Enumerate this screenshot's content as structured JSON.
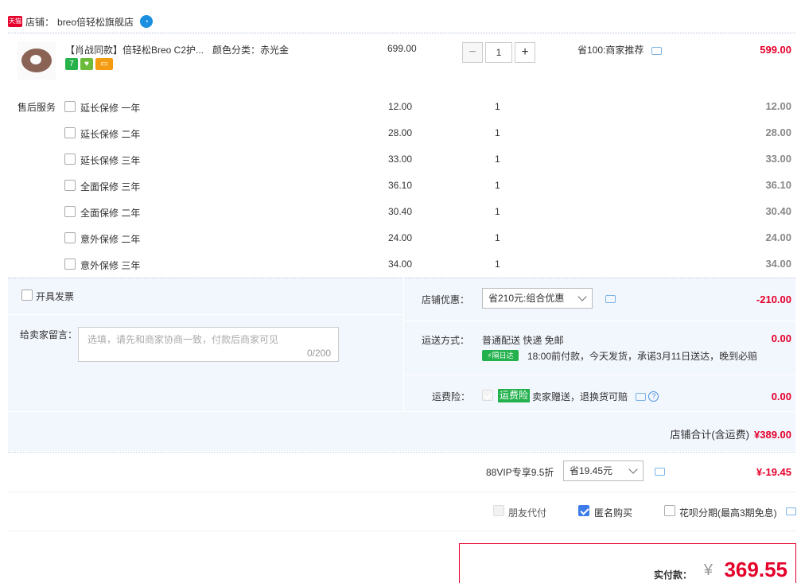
{
  "store": {
    "badge": "天猫",
    "label": "店铺：",
    "name": "breo倍轻松旗舰店"
  },
  "product": {
    "title": "【肖战同款】倍轻松Breo C2护...",
    "color_label": "颜色分类：",
    "color_value": "赤光金",
    "unit_price": "699.00",
    "quantity": "1",
    "promo": "省100:商家推荐",
    "subtotal": "599.00",
    "badges": [
      "7",
      "♥",
      "▭"
    ]
  },
  "services": {
    "label": "售后服务",
    "items": [
      {
        "name": "延长保修 一年",
        "price": "12.00",
        "qty": "1",
        "total": "12.00"
      },
      {
        "name": "延长保修 二年",
        "price": "28.00",
        "qty": "1",
        "total": "28.00"
      },
      {
        "name": "延长保修 三年",
        "price": "33.00",
        "qty": "1",
        "total": "33.00"
      },
      {
        "name": "全面保修 三年",
        "price": "36.10",
        "qty": "1",
        "total": "36.10"
      },
      {
        "name": "全面保修 二年",
        "price": "30.40",
        "qty": "1",
        "total": "30.40"
      },
      {
        "name": "意外保修 二年",
        "price": "24.00",
        "qty": "1",
        "total": "24.00"
      },
      {
        "name": "意外保修 三年",
        "price": "34.00",
        "qty": "1",
        "total": "34.00"
      }
    ]
  },
  "invoice": {
    "label": "开具发票"
  },
  "message": {
    "label": "给卖家留言：",
    "placeholder": "选填，请先和商家协商一致，付款后商家可见",
    "count": "0/200"
  },
  "store_discount": {
    "label": "店铺优惠：",
    "selected": "省210元:组合优惠",
    "amount": "-210.00"
  },
  "shipping": {
    "label": "运送方式：",
    "method": "普通配送 快递 免邮",
    "amount": "0.00",
    "badge": "隔日达",
    "note": "18:00前付款，今天发货，承诺3月11日送达，晚到必赔"
  },
  "insurance": {
    "label": "运费险：",
    "tag": "运费险",
    "text": "卖家赠送，退换货可赔",
    "amount": "0.00"
  },
  "store_total": {
    "label": "店铺合计(含运费)",
    "amount": "¥389.00"
  },
  "vip": {
    "label": "88VIP专享9.5折",
    "selected": "省19.45元",
    "amount": "¥-19.45"
  },
  "options": {
    "friend_pay": "朋友代付",
    "anonymous": "匿名购买",
    "huabei": "花呗分期(最高3期免息)"
  },
  "payment": {
    "label": "实付款：",
    "currency": "¥",
    "amount": "369.55"
  },
  "colors": {
    "accent_red": "#e4002b",
    "panel_bg": "#f2f6fd",
    "check_blue": "#3b7bea",
    "green": "#22b14c"
  }
}
